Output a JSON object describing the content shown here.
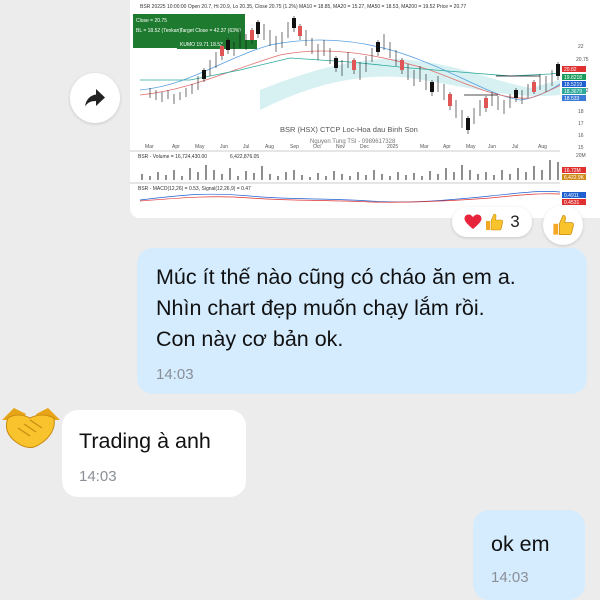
{
  "shared_image": {
    "top_strip": "BSR 20225 10:00:00 Open 20.7, Hi 20.9, Lo 20.35, Close 20.75 (1.2%) MA10 = 18.85, MA20 = 15.27, MA50 = 18.53, MA200 = 19.52 Price = 20.77",
    "legend_lines": [
      "Close = 20.75",
      "BL = 18.52 (Tenkan)",
      "Target Close = 42.37 (63%)",
      "KUMO 19.71 18.53"
    ],
    "months": [
      "Mar",
      "Apr",
      "May",
      "Jun",
      "Jul",
      "Aug",
      "Sep",
      "Oct",
      "Nov",
      "Dec",
      "2025",
      "Mar",
      "Apr",
      "May",
      "Jun",
      "Jul",
      "Aug"
    ],
    "price_scale": [
      "22",
      "20.75",
      "19.52",
      "19",
      "18",
      "17",
      "16",
      "15"
    ],
    "price_tags": [
      "20.82",
      "19.8218",
      "18.5219",
      "18.3679",
      "18.533"
    ],
    "watermark_title": "BSR (HSX) CTCP Loc-Hoa dau Binh Son",
    "watermark_author": "Nguyen Tung TSI - 0989617328",
    "volume_label": "BSR - Volume = 16,724,430.00",
    "volume_avg": "6,422,876.05",
    "volume_scale": "20M",
    "volume_tags": [
      "16.72M",
      "6,422.9K"
    ],
    "macd_label": "BSR - MACD(12,26) = 0.53, Signal(12,26,9) = 0.47",
    "macd_tags": [
      "0.4911",
      "0.4531"
    ]
  },
  "reactions": {
    "heart_icon": "heart-icon",
    "thumbs_icon": "thumbs-up-icon",
    "count": "3"
  },
  "messages": [
    {
      "direction": "out",
      "text": "Múc ít thế nào cũng có cháo ăn em a.\nNhìn chart đẹp muốn chạy lắm rồi.\nCon này cơ bản ok.",
      "time": "14:03"
    },
    {
      "direction": "in",
      "text": "Trading à anh",
      "time": "14:03"
    },
    {
      "direction": "out",
      "text": "ok em",
      "time": "14:03"
    }
  ],
  "colors": {
    "background": "#ececec",
    "outgoing_bubble": "#d5ecff",
    "incoming_bubble": "#ffffff",
    "time_text": "#8a8f96"
  }
}
